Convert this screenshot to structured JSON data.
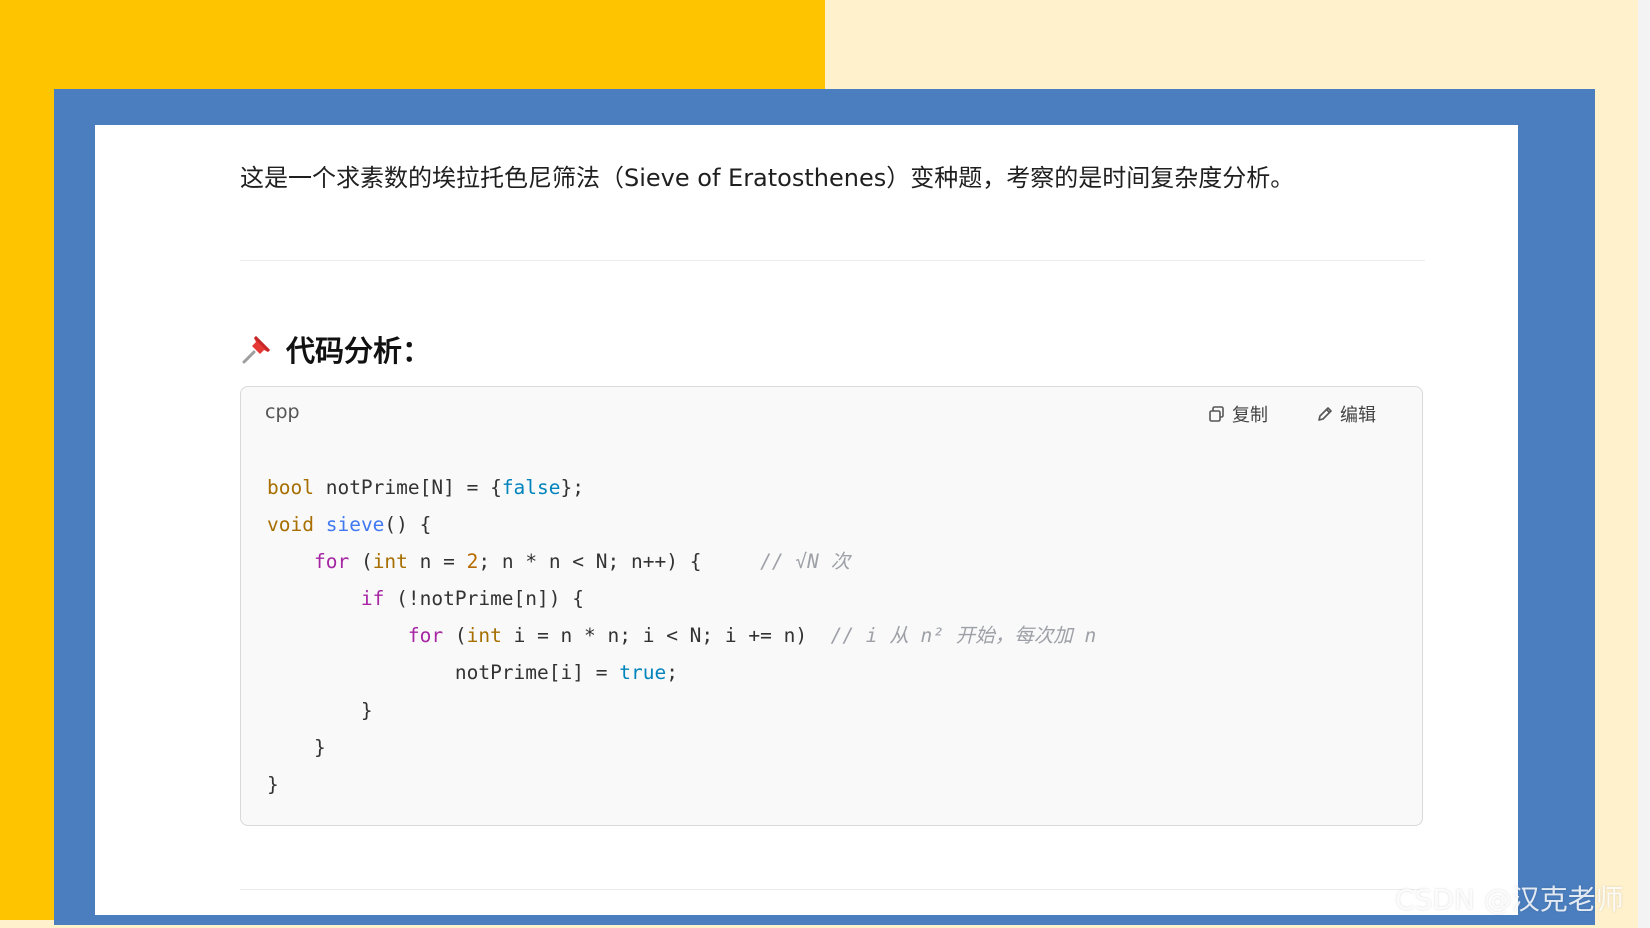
{
  "intro_text": "这是一个求素数的埃拉托色尼筛法（Sieve of Eratosthenes）变种题，考察的是时间复杂度分析。",
  "section": {
    "title": "代码分析：",
    "icon": "pushpin-icon"
  },
  "code_block": {
    "language": "cpp",
    "copy_label": "复制",
    "edit_label": "编辑",
    "lines": [
      {
        "indent": "",
        "tokens": [
          [
            "kw",
            "bool"
          ],
          [
            "p",
            " notPrime[N] = {"
          ],
          [
            "lit",
            "false"
          ],
          [
            "p",
            "};"
          ]
        ]
      },
      {
        "indent": "",
        "tokens": [
          [
            "kw",
            "void"
          ],
          [
            "p",
            " "
          ],
          [
            "fn",
            "sieve"
          ],
          [
            "p",
            "() {"
          ]
        ]
      },
      {
        "indent": "    ",
        "tokens": [
          [
            "ctl",
            "for"
          ],
          [
            "p",
            " ("
          ],
          [
            "kw",
            "int"
          ],
          [
            "p",
            " n = "
          ],
          [
            "num",
            "2"
          ],
          [
            "p",
            "; n * n < N; n++) {     "
          ],
          [
            "cm",
            "// √N 次"
          ]
        ]
      },
      {
        "indent": "        ",
        "tokens": [
          [
            "ctl",
            "if"
          ],
          [
            "p",
            " (!notPrime[n]) {"
          ]
        ]
      },
      {
        "indent": "            ",
        "tokens": [
          [
            "ctl",
            "for"
          ],
          [
            "p",
            " ("
          ],
          [
            "kw",
            "int"
          ],
          [
            "p",
            " i = n * n; i < N; i += n)  "
          ],
          [
            "cm",
            "// i 从 n² 开始，每次加 n"
          ]
        ]
      },
      {
        "indent": "                ",
        "tokens": [
          [
            "p",
            "notPrime[i] = "
          ],
          [
            "lit",
            "true"
          ],
          [
            "p",
            ";"
          ]
        ]
      },
      {
        "indent": "        ",
        "tokens": [
          [
            "p",
            "}"
          ]
        ]
      },
      {
        "indent": "    ",
        "tokens": [
          [
            "p",
            "}"
          ]
        ]
      },
      {
        "indent": "",
        "tokens": [
          [
            "p",
            "}"
          ]
        ]
      }
    ]
  },
  "watermark": "CSDN @汉克老师",
  "colors": {
    "yellow_bg": "#ffc400",
    "cream_bg": "#fff1cc",
    "frame_blue": "#4a7ebe",
    "pin_red": "#e53935"
  }
}
